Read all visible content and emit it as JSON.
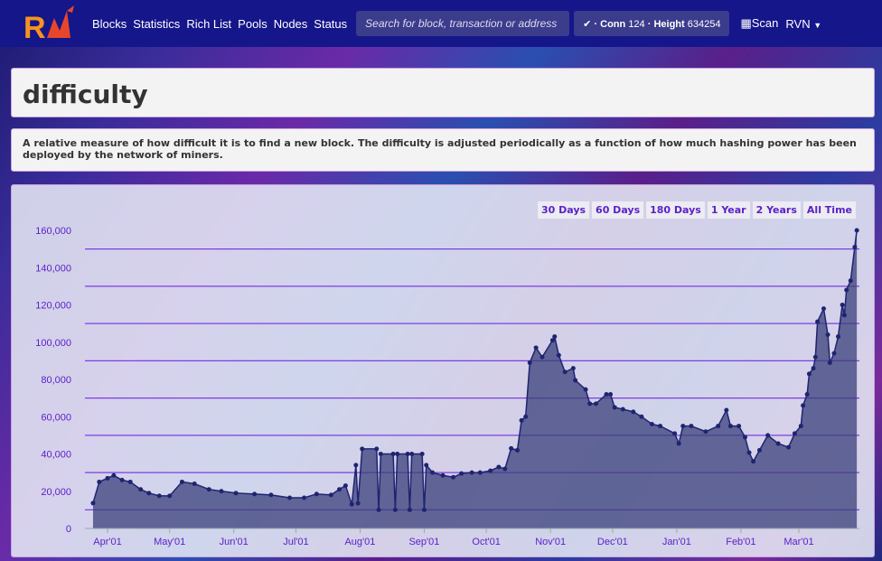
{
  "nav": {
    "logo_text": "RVN",
    "items": [
      "Blocks",
      "Statistics",
      "Rich List",
      "Pools",
      "Nodes",
      "Status"
    ],
    "search_placeholder": "Search for block, transaction or address",
    "conn_label": "Conn",
    "conn_value": "124",
    "height_label": "Height",
    "height_value": "634254",
    "scan_label": "Scan",
    "currency": "RVN"
  },
  "page": {
    "title": "difficulty",
    "description": "A relative measure of how difficult it is to find a new block. The difficulty is adjusted periodically as a function of how much hashing power has been deployed by the network of miners."
  },
  "ranges": [
    "30 Days",
    "60 Days",
    "180 Days",
    "1 Year",
    "2 Years",
    "All Time"
  ],
  "colors": {
    "nav": "#15168a",
    "series": "#1f2470",
    "fill": "#3a3f7a",
    "grid": "#7b3fe0",
    "axis_text": "#5a22c8"
  },
  "chart_data": {
    "type": "area",
    "title": "",
    "xlabel": "",
    "ylabel": "",
    "ylim": [
      0,
      160000
    ],
    "grid": true,
    "y_ticks": [
      "0",
      "20,000",
      "40,000",
      "60,000",
      "80,000",
      "100,000",
      "120,000",
      "140,000",
      "160,000"
    ],
    "x_ticks": [
      [
        "2018-04-01",
        "Apr'01"
      ],
      [
        "2018-05-01",
        "May'01"
      ],
      [
        "2018-06-01",
        "Jun'01"
      ],
      [
        "2018-07-01",
        "Jul'01"
      ],
      [
        "2018-08-01",
        "Aug'01"
      ],
      [
        "2018-09-01",
        "Sep'01"
      ],
      [
        "2018-10-01",
        "Oct'01"
      ],
      [
        "2018-11-01",
        "Nov'01"
      ],
      [
        "2018-12-01",
        "Dec'01"
      ],
      [
        "2019-01-01",
        "Jan'01"
      ],
      [
        "2019-02-01",
        "Feb'01"
      ],
      [
        "2019-03-01",
        "Mar'01"
      ]
    ],
    "points": [
      [
        "2018-03-25",
        13600
      ],
      [
        "2018-03-28",
        25000
      ],
      [
        "2018-04-01",
        27000
      ],
      [
        "2018-04-04",
        28500
      ],
      [
        "2018-04-08",
        26000
      ],
      [
        "2018-04-12",
        25000
      ],
      [
        "2018-04-17",
        21000
      ],
      [
        "2018-04-21",
        19000
      ],
      [
        "2018-04-26",
        17500
      ],
      [
        "2018-05-01",
        17500
      ],
      [
        "2018-05-07",
        25000
      ],
      [
        "2018-05-13",
        24000
      ],
      [
        "2018-05-20",
        21000
      ],
      [
        "2018-05-26",
        20000
      ],
      [
        "2018-06-02",
        19000
      ],
      [
        "2018-06-11",
        18500
      ],
      [
        "2018-06-19",
        18000
      ],
      [
        "2018-06-28",
        16500
      ],
      [
        "2018-07-05",
        16500
      ],
      [
        "2018-07-11",
        18500
      ],
      [
        "2018-07-18",
        18000
      ],
      [
        "2018-07-22",
        21000
      ],
      [
        "2018-07-25",
        23000
      ],
      [
        "2018-07-28",
        13000
      ],
      [
        "2018-07-30",
        34000
      ],
      [
        "2018-07-31",
        13500
      ],
      [
        "2018-08-02",
        42700
      ],
      [
        "2018-08-09",
        42700
      ],
      [
        "2018-08-10",
        10000
      ],
      [
        "2018-08-11",
        40000
      ],
      [
        "2018-08-17",
        40000
      ],
      [
        "2018-08-18",
        10000
      ],
      [
        "2018-08-19",
        40000
      ],
      [
        "2018-08-24",
        40000
      ],
      [
        "2018-08-25",
        10000
      ],
      [
        "2018-08-26",
        40000
      ],
      [
        "2018-08-31",
        40000
      ],
      [
        "2018-09-01",
        10000
      ],
      [
        "2018-09-02",
        34000
      ],
      [
        "2018-09-05",
        30000
      ],
      [
        "2018-09-10",
        28500
      ],
      [
        "2018-09-15",
        27500
      ],
      [
        "2018-09-19",
        29500
      ],
      [
        "2018-09-24",
        30000
      ],
      [
        "2018-09-28",
        30000
      ],
      [
        "2018-10-03",
        31000
      ],
      [
        "2018-10-07",
        33000
      ],
      [
        "2018-10-10",
        32000
      ],
      [
        "2018-10-13",
        43000
      ],
      [
        "2018-10-16",
        42000
      ],
      [
        "2018-10-18",
        58000
      ],
      [
        "2018-10-20",
        60000
      ],
      [
        "2018-10-22",
        89000
      ],
      [
        "2018-10-25",
        97000
      ],
      [
        "2018-10-28",
        92000
      ],
      [
        "2018-11-02",
        101000
      ],
      [
        "2018-11-03",
        103000
      ],
      [
        "2018-11-05",
        93000
      ],
      [
        "2018-11-08",
        84000
      ],
      [
        "2018-11-12",
        86000
      ],
      [
        "2018-11-13",
        79500
      ],
      [
        "2018-11-18",
        74600
      ],
      [
        "2018-11-20",
        67000
      ],
      [
        "2018-11-23",
        67000
      ],
      [
        "2018-11-28",
        72000
      ],
      [
        "2018-11-30",
        72000
      ],
      [
        "2018-12-02",
        65000
      ],
      [
        "2018-12-06",
        64000
      ],
      [
        "2018-12-11",
        62600
      ],
      [
        "2018-12-15",
        60000
      ],
      [
        "2018-12-20",
        56000
      ],
      [
        "2018-12-24",
        55000
      ],
      [
        "2018-12-31",
        51000
      ],
      [
        "2019-01-02",
        45600
      ],
      [
        "2019-01-04",
        55000
      ],
      [
        "2019-01-08",
        55000
      ],
      [
        "2019-01-15",
        52000
      ],
      [
        "2019-01-21",
        55000
      ],
      [
        "2019-01-25",
        63500
      ],
      [
        "2019-01-27",
        55000
      ],
      [
        "2019-01-31",
        55000
      ],
      [
        "2019-02-03",
        49000
      ],
      [
        "2019-02-05",
        40700
      ],
      [
        "2019-02-07",
        36000
      ],
      [
        "2019-02-10",
        42000
      ],
      [
        "2019-02-14",
        50000
      ],
      [
        "2019-02-19",
        45600
      ],
      [
        "2019-02-24",
        43600
      ],
      [
        "2019-02-27",
        51000
      ],
      [
        "2019-03-02",
        55000
      ],
      [
        "2019-03-03",
        66000
      ],
      [
        "2019-03-05",
        72000
      ],
      [
        "2019-03-06",
        83000
      ],
      [
        "2019-03-08",
        86000
      ],
      [
        "2019-03-09",
        92000
      ],
      [
        "2019-03-10",
        111000
      ],
      [
        "2019-03-13",
        118000
      ],
      [
        "2019-03-15",
        104000
      ],
      [
        "2019-03-16",
        89000
      ],
      [
        "2019-03-18",
        94000
      ],
      [
        "2019-03-20",
        103000
      ],
      [
        "2019-03-22",
        120000
      ],
      [
        "2019-03-23",
        114500
      ],
      [
        "2019-03-24",
        128000
      ],
      [
        "2019-03-26",
        133000
      ],
      [
        "2019-03-28",
        151000
      ],
      [
        "2019-03-29",
        160000
      ]
    ]
  }
}
